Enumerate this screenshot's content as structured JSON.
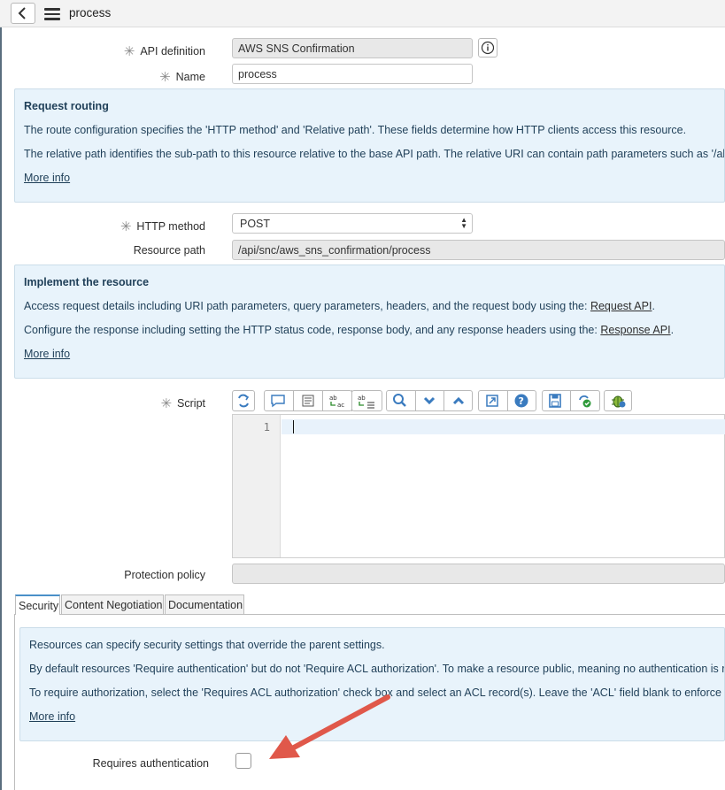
{
  "header": {
    "title": "process"
  },
  "form": {
    "api_definition": {
      "label": "API definition",
      "value": "AWS SNS Confirmation"
    },
    "name": {
      "label": "Name",
      "value": "process"
    },
    "http_method": {
      "label": "HTTP method",
      "value": "POST"
    },
    "resource_path": {
      "label": "Resource path",
      "value": "/api/snc/aws_sns_confirmation/process"
    },
    "script": {
      "label": "Script",
      "line_number": "1"
    },
    "protection_policy": {
      "label": "Protection policy",
      "value": ""
    },
    "requires_auth": {
      "label": "Requires authentication"
    }
  },
  "routing_help": {
    "heading": "Request routing",
    "line1": "The route configuration specifies the 'HTTP method' and 'Relative path'. These fields determine how HTTP clients access this resource.",
    "line2": "The relative path identifies the sub-path to this resource relative to the base API path. The relative URI can contain path parameters such as '/abc/{id}'",
    "more": "More info"
  },
  "implement_help": {
    "heading": "Implement the resource",
    "line1_pre": "Access request details including URI path parameters, query parameters, headers, and the request body using the: ",
    "line1_link": "Request API",
    "line1_post": ".",
    "line2_pre": "Configure the response including setting the HTTP status code, response body, and any response headers using the: ",
    "line2_link": "Response API",
    "line2_post": ".",
    "more": "More info"
  },
  "tabs": [
    {
      "label": "Security"
    },
    {
      "label": "Content Negotiation"
    },
    {
      "label": "Documentation"
    }
  ],
  "security_help": {
    "line1": "Resources can specify security settings that override the parent settings.",
    "line2": "By default resources 'Require authentication' but do not 'Require ACL authorization'. To make a resource public, meaning no authentication is required",
    "line3": "To require authorization, select the 'Requires ACL authorization' check box and select an ACL record(s). Leave the 'ACL' field blank to enforce the 'Default'",
    "more": "More info"
  },
  "colors": {
    "help_bg": "#e8f3fb",
    "arrow": "#e0584a",
    "tab_accent": "#4a90c8"
  },
  "icons": [
    "back-chevron-icon",
    "hamburger-menu-icon",
    "info-icon",
    "required-asterisk-icon",
    "select-arrows-icon",
    "format-code-icon",
    "comment-icon",
    "align-icon",
    "replace-icon",
    "replace-all-icon",
    "search-icon",
    "chevron-down-icon",
    "chevron-up-icon",
    "fullscreen-icon",
    "help-icon",
    "save-icon",
    "syntax-check-icon",
    "debug-icon",
    "annotation-arrow-icon"
  ]
}
